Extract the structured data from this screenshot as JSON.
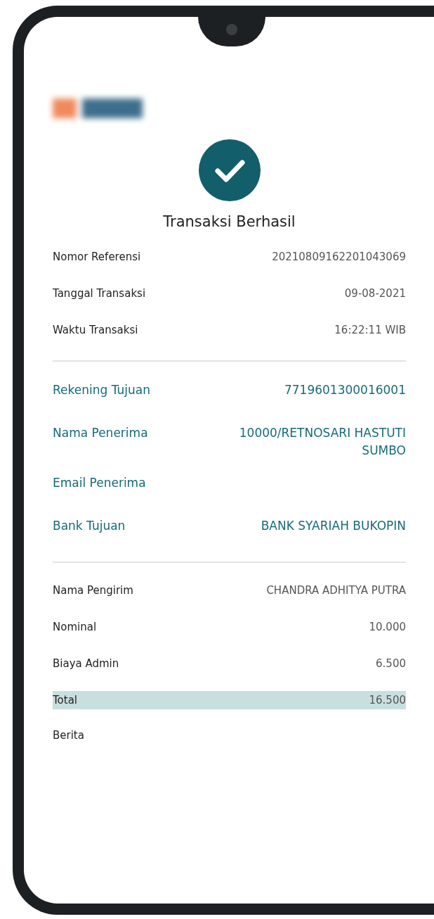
{
  "title": "Transaksi Berhasil",
  "sections": [
    {
      "kind": "details",
      "rows": [
        {
          "label": "Nomor Referensi",
          "value": "20210809162201043069",
          "highlighted": false
        },
        {
          "label": "Tanggal Transaksi",
          "value": "09-08-2021",
          "highlighted": false
        },
        {
          "label": "Waktu Transaksi",
          "value": "16:22:11 WIB",
          "highlighted": false
        }
      ]
    },
    {
      "kind": "recipient",
      "rows": [
        {
          "label": "Rekening Tujuan",
          "value": "7719601300016001",
          "highlighted": false
        },
        {
          "label": "Nama Penerima",
          "value": "10000/RETNOSARI HASTUTI SUMBO",
          "highlighted": false
        },
        {
          "label": "Email Penerima",
          "highlighted": false
        },
        {
          "label": "Bank Tujuan",
          "value": "BANK SYARIAH BUKOPIN",
          "highlighted": false
        }
      ]
    },
    {
      "kind": "details",
      "rows": [
        {
          "label": "Nama Pengirim",
          "value": "CHANDRA ADHITYA PUTRA",
          "highlighted": false
        },
        {
          "label": "Nominal",
          "value": "10.000",
          "highlighted": false
        },
        {
          "label": "Biaya Admin",
          "value": "6.500",
          "highlighted": false
        },
        {
          "label": "Total",
          "value": "16.500",
          "highlighted": true
        },
        {
          "label": "Berita",
          "highlighted": false
        }
      ]
    }
  ]
}
